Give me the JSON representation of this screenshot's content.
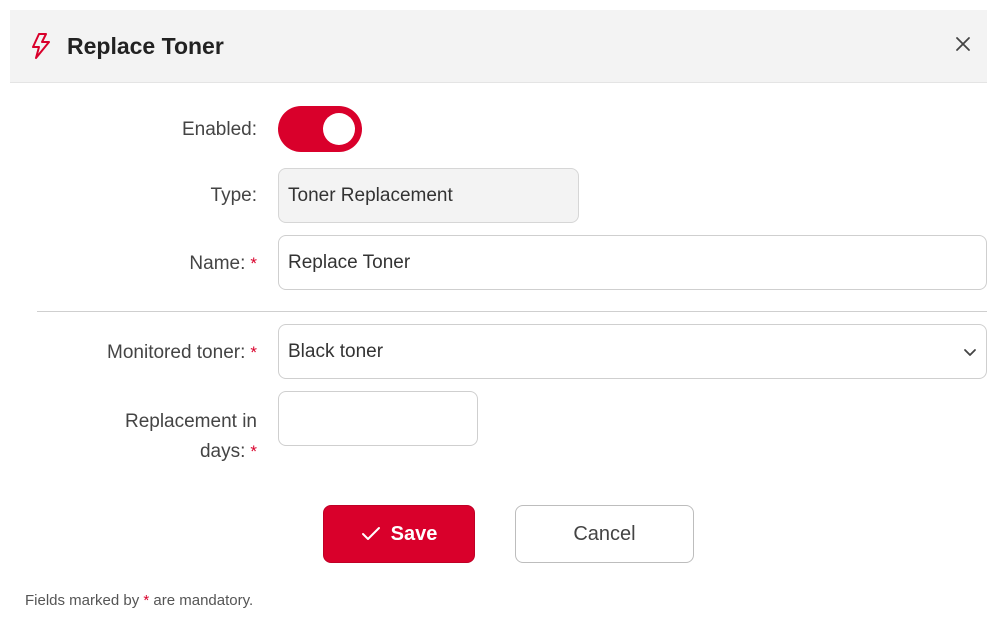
{
  "dialog": {
    "title": "Replace Toner",
    "icon": "lightning-icon",
    "close_icon": "close-icon",
    "close_glyph": "×"
  },
  "form": {
    "enabled_label": "Enabled:",
    "enabled_value": true,
    "type_label": "Type:",
    "type_value": "Toner Replacement",
    "name_label": "Name:",
    "name_value": "Replace Toner",
    "monitored_toner_label": "Monitored toner:",
    "monitored_toner_value": "Black toner",
    "replacement_label_line1": "Replacement in",
    "replacement_label_line2": "days:",
    "replacement_value": "",
    "required_marker": "*"
  },
  "actions": {
    "save_label": "Save",
    "cancel_label": "Cancel"
  },
  "footer": {
    "note_prefix": "Fields marked by",
    "note_star": "*",
    "note_suffix": "are mandatory."
  },
  "colors": {
    "accent": "#d9002b",
    "header_bg": "#f3f3f3"
  }
}
